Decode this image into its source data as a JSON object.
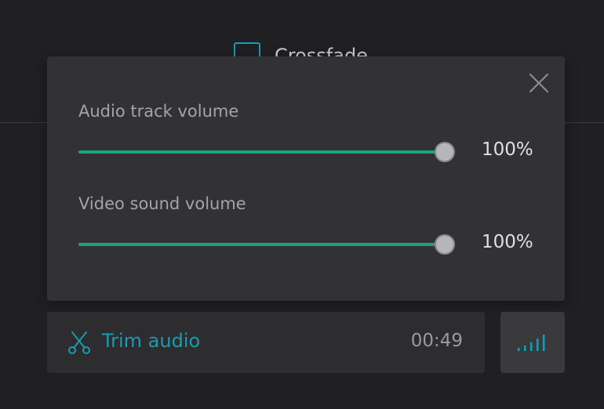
{
  "background": {
    "crossfade_label": "Crossfade"
  },
  "volume_panel": {
    "audio_track": {
      "label": "Audio track volume",
      "value": 100,
      "value_text": "100%"
    },
    "video_sound": {
      "label": "Video sound volume",
      "value": 100,
      "value_text": "100%"
    },
    "close_icon": "close-icon"
  },
  "trim": {
    "icon": "scissors-icon",
    "label": "Trim audio",
    "duration": "00:49"
  },
  "volume_button": {
    "icon": "volume-bars-icon"
  },
  "colors": {
    "background": "#202022",
    "panel": "#323234",
    "accent_green": "#19a47f",
    "accent_teal": "#1a9bb0",
    "label_gray": "#a4a4a6",
    "value_text": "#e0e0e0"
  }
}
